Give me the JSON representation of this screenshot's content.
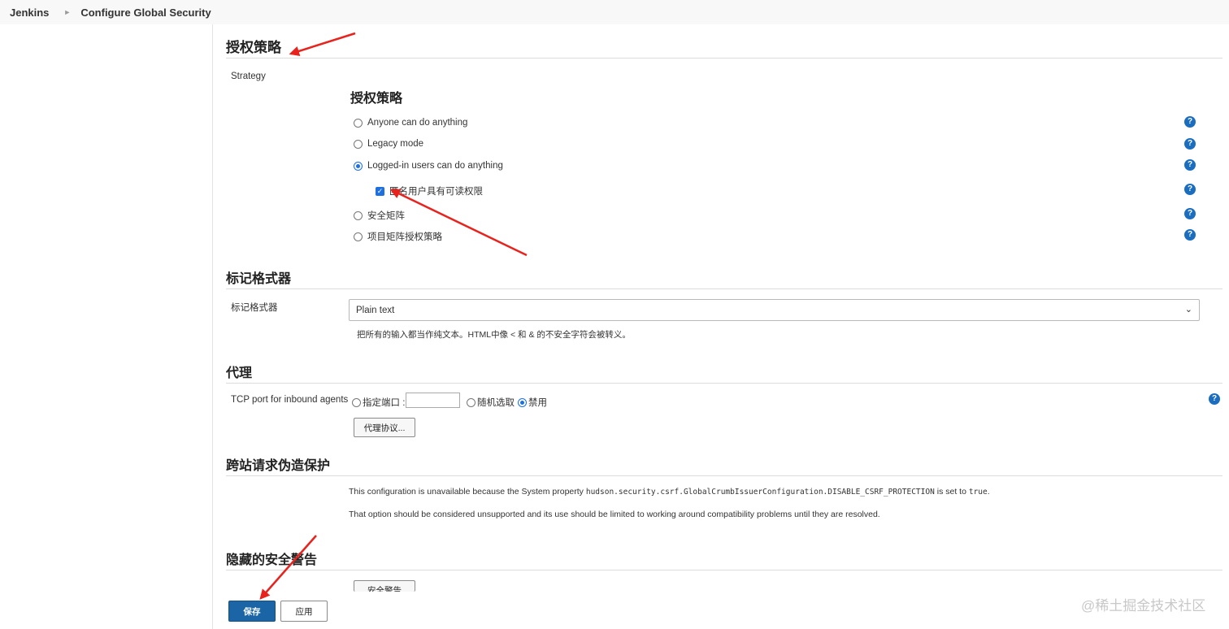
{
  "breadcrumb": {
    "root": "Jenkins",
    "current": "Configure Global Security"
  },
  "authorization": {
    "section_title": "授权策略",
    "strategy_label": "Strategy",
    "sub_title": "授权策略",
    "options": [
      {
        "label": "Anyone can do anything",
        "selected": false
      },
      {
        "label": "Legacy mode",
        "selected": false
      },
      {
        "label": "Logged-in users can do anything",
        "selected": true
      },
      {
        "label": "安全矩阵",
        "selected": false
      },
      {
        "label": "项目矩阵授权策略",
        "selected": false
      }
    ],
    "anonymous_read": {
      "label": "匿名用户具有可读权限",
      "checked": true
    }
  },
  "markup": {
    "section_title": "标记格式器",
    "label": "标记格式器",
    "selected": "Plain text",
    "description": "把所有的输入都当作纯文本。HTML中像 < 和 & 的不安全字符会被转义。"
  },
  "agents": {
    "section_title": "代理",
    "label": "TCP port for inbound agents",
    "opt_fixed": "指定端口 :",
    "opt_random": "随机选取",
    "opt_disable": "禁用",
    "selected": "禁用",
    "protocols_button": "代理协议..."
  },
  "csrf": {
    "section_title": "跨站请求伪造保护",
    "text_prefix": "This configuration is unavailable because the System property",
    "property": "hudson.security.csrf.GlobalCrumbIssuerConfiguration.DISABLE_CSRF_PROTECTION",
    "text_mid": "is set to",
    "value": "true",
    "text_end": ".",
    "note2": "That option should be considered unsupported and its use should be limited to working around compatibility problems until they are resolved."
  },
  "hidden_warnings": {
    "section_title": "隐藏的安全警告",
    "button": "安全警告"
  },
  "footer": {
    "save": "保存",
    "apply": "应用"
  },
  "watermark": "@稀土掘金技术社区",
  "colors": {
    "accent": "#1e6fe0",
    "primary_button": "#1b64a6",
    "help_icon": "#1a6dbf",
    "annotation_arrow": "#e8231e"
  },
  "icons": {
    "help": "question-circle-icon",
    "chevron": "chevron-down-icon",
    "breadcrumb_separator": "chevron-right-icon"
  }
}
